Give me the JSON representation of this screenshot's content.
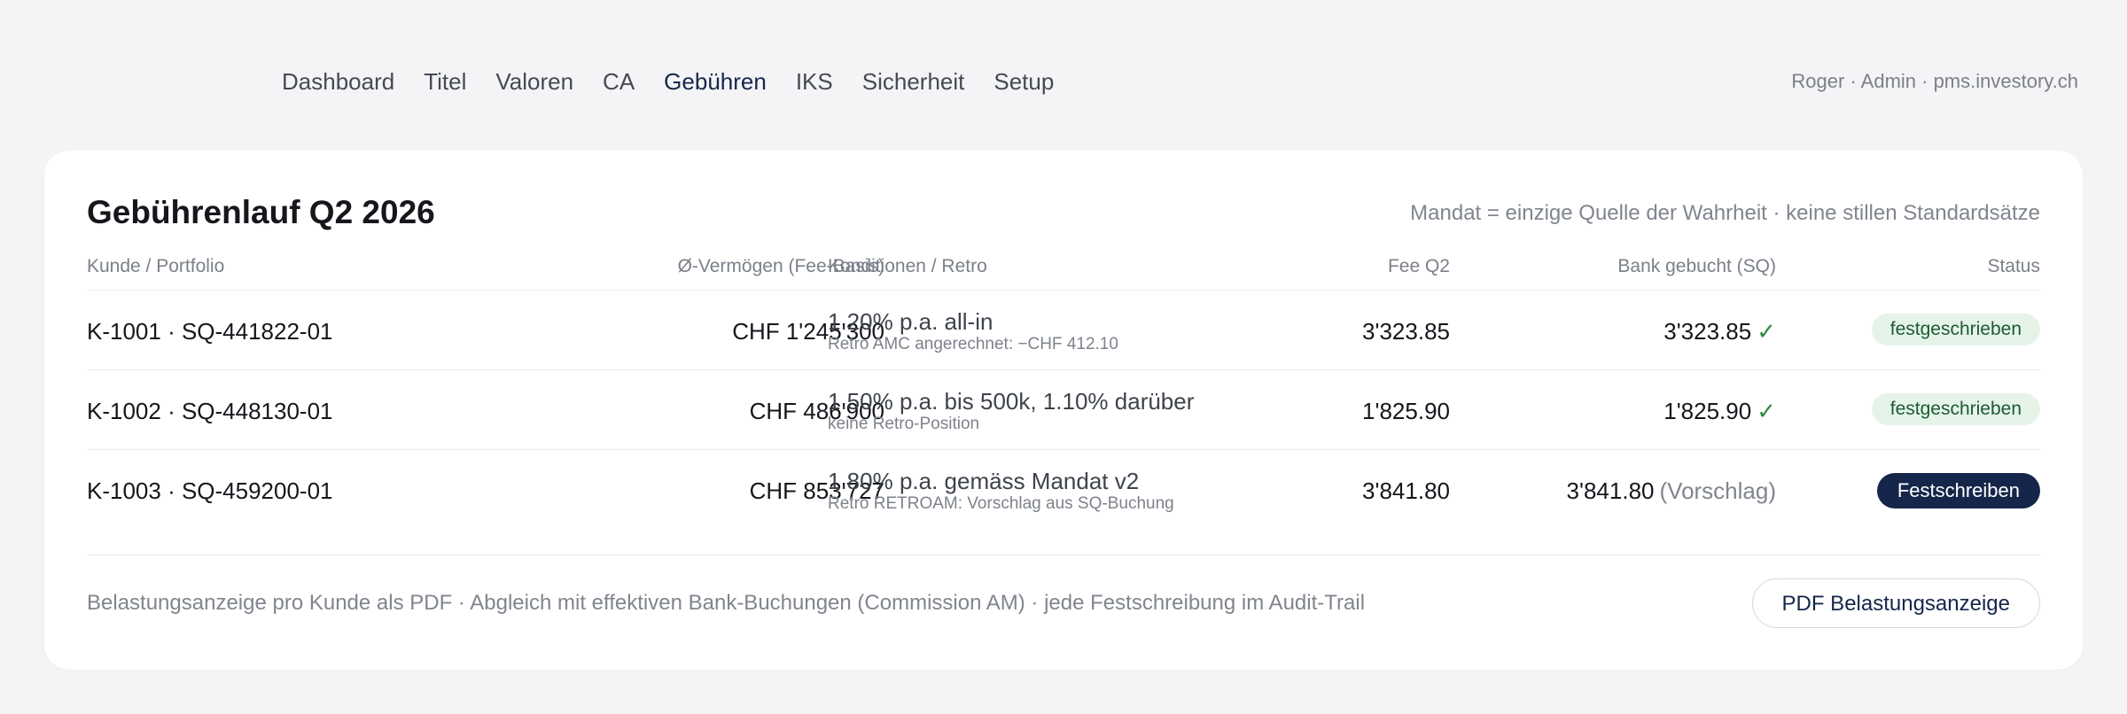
{
  "nav": {
    "items": [
      {
        "label": "Dashboard"
      },
      {
        "label": "Titel"
      },
      {
        "label": "Valoren"
      },
      {
        "label": "CA"
      },
      {
        "label": "Gebühren",
        "active": true
      },
      {
        "label": "IKS"
      },
      {
        "label": "Sicherheit"
      },
      {
        "label": "Setup"
      }
    ],
    "user_info": "Roger · Admin · pms.investory.ch"
  },
  "card": {
    "title": "Gebührenlauf Q2 2026",
    "subtitle": "Mandat = einzige Quelle der Wahrheit · keine stillen Standardsätze",
    "columns": {
      "client": "Kunde / Portfolio",
      "aum": "Ø-Vermögen (Fee-Basis)",
      "conditions": "Konditionen / Retro",
      "fee": "Fee Q2",
      "bank": "Bank gebucht (SQ)",
      "status": "Status"
    },
    "rows": [
      {
        "client": "K-1001 · SQ-441822-01",
        "aum": "CHF 1'245'300",
        "cond_main": "1.20% p.a. all-in",
        "cond_sub": "Retro AMC angerechnet: −CHF 412.10",
        "fee": "3'323.85",
        "bank": "3'323.85",
        "bank_mark": "✓",
        "status": "festgeschrieben"
      },
      {
        "client": "K-1002 · SQ-448130-01",
        "aum": "CHF 486'900",
        "cond_main": "1.50% p.a. bis 500k, 1.10% darüber",
        "cond_sub": "keine Retro-Position",
        "fee": "1'825.90",
        "bank": "1'825.90",
        "bank_mark": "✓",
        "status": "festgeschrieben"
      },
      {
        "client": "K-1003 · SQ-459200-01",
        "aum": "CHF 853'727",
        "cond_main": "1.80% p.a. gemäss Mandat v2",
        "cond_sub": "Retro RETROAM: Vorschlag aus SQ-Buchung",
        "fee": "3'841.80",
        "bank": "3'841.80",
        "bank_note": "(Vorschlag)",
        "action": "Festschreiben"
      }
    ],
    "footer_text": "Belastungsanzeige pro Kunde als PDF · Abgleich mit effektiven Bank-Buchungen (Commission AM) · jede Festschreibung im Audit-Trail",
    "pdf_button": "PDF Belastungsanzeige"
  },
  "colors": {
    "accent": "#15264a",
    "success": "#2a8a3e",
    "badge_bg": "#e5f3e8",
    "page_bg": "#f4f4f6"
  },
  "icons": {
    "check": "check-icon"
  }
}
